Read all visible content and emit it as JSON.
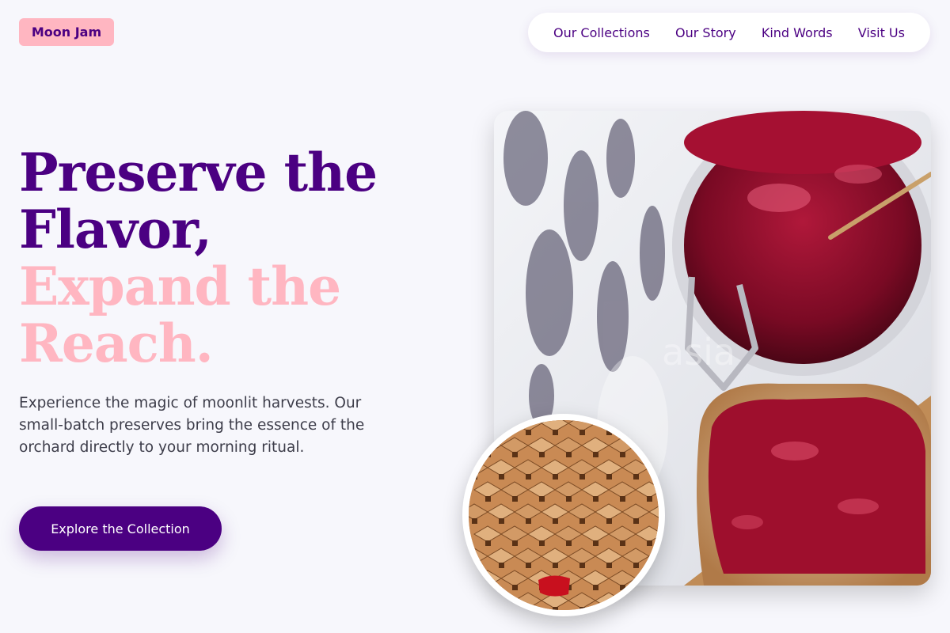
{
  "brand": {
    "logo": "Moon Jam"
  },
  "nav": {
    "items": [
      {
        "label": "Our Collections"
      },
      {
        "label": "Our Story"
      },
      {
        "label": "Kind Words"
      },
      {
        "label": "Visit Us"
      }
    ]
  },
  "hero": {
    "title_line1": "Preserve the",
    "title_line2": "Flavor,",
    "title_line3": "Expand the",
    "title_line4": "Reach.",
    "body": "Experience the magic of moonlit harvests. Our small-batch preserves bring the essence of the orchard directly to your morning ritual.",
    "cta_label": "Explore the Collection"
  },
  "images": {
    "main_watermark": "asia"
  },
  "colors": {
    "brand_purple": "#4b0082",
    "brand_pink": "#ffb6c1",
    "background": "#f7f7fc"
  }
}
